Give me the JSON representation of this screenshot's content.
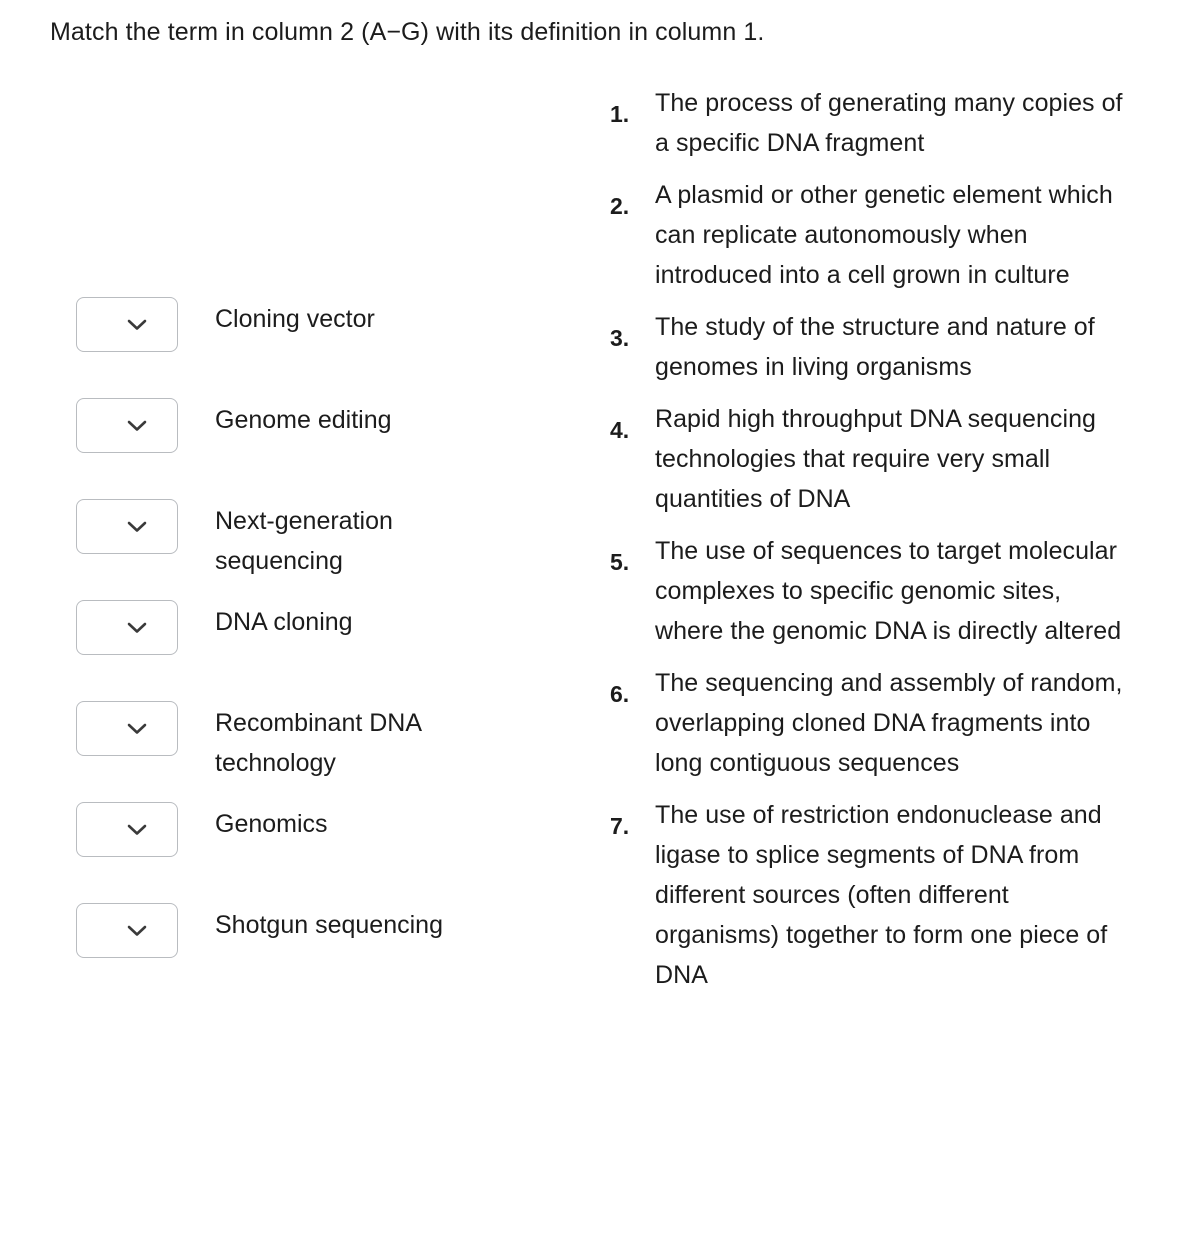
{
  "heading": {
    "text": "Match the term in column 2 (A−G) with its definition in column 1."
  },
  "terms": {
    "dropdown_icon": "chevron-down-icon",
    "dropdown_selected_value": "",
    "items": [
      {
        "label": "Cloning vector"
      },
      {
        "label": "Genome editing"
      },
      {
        "label": "Next-generation sequencing"
      },
      {
        "label": "DNA cloning"
      },
      {
        "label": "Recombinant DNA technology"
      },
      {
        "label": "Genomics"
      },
      {
        "label": "Shotgun sequencing"
      }
    ]
  },
  "definitions": {
    "items": [
      {
        "number": "1.",
        "text": "The process of generating many copies of a specific DNA fragment"
      },
      {
        "number": "2.",
        "text": "A plasmid or other genetic element which can replicate autonomously when introduced into a cell grown in culture"
      },
      {
        "number": "3.",
        "text": "The study of the structure and nature of genomes in living organisms"
      },
      {
        "number": "4.",
        "text": "Rapid high throughput DNA sequencing technologies that require very small quantities of DNA"
      },
      {
        "number": "5.",
        "text": "The use of sequences to target molecular complexes to specific genomic sites, where the genomic DNA is directly altered"
      },
      {
        "number": "6.",
        "text": "The sequencing and assembly of random, overlapping cloned DNA fragments into long contiguous sequences"
      },
      {
        "number": "7.",
        "text": "The use of restriction endonuclease and ligase to splice segments of DNA from different sources (often different organisms) together to form one piece of DNA"
      }
    ]
  },
  "colors": {
    "text": "#1c1c1c",
    "dropdown_border": "#b9bcc0",
    "background": "#ffffff",
    "chevron": "#3a3a3a"
  }
}
